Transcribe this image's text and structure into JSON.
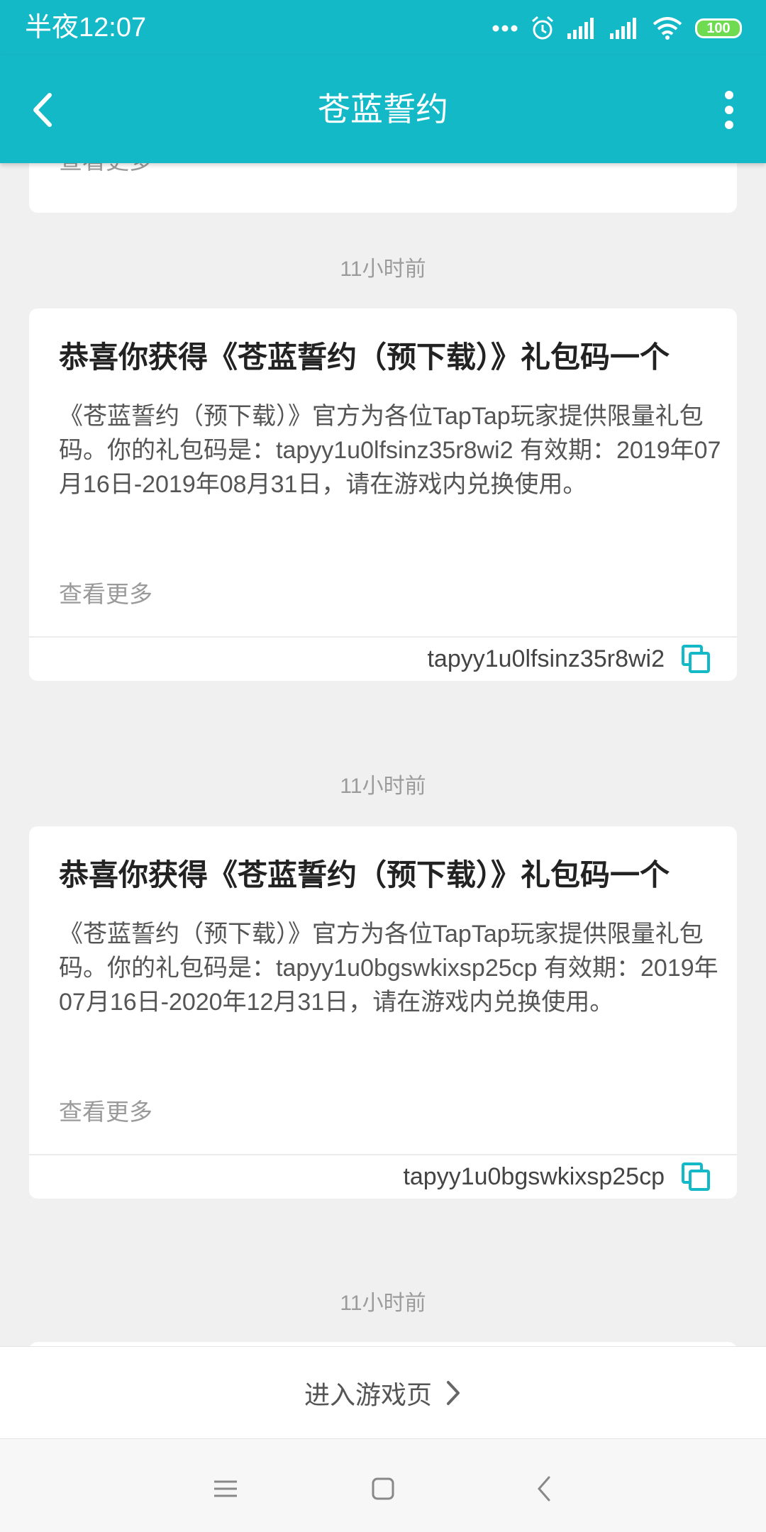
{
  "status_bar": {
    "time": "半夜12:07",
    "battery": "100"
  },
  "app_bar": {
    "title": "苍蓝誓约"
  },
  "feed": {
    "partial_see_more": "查看更多",
    "items": [
      {
        "timestamp": "11小时前",
        "title": "恭喜你获得《苍蓝誓约（预下载）》礼包码一个",
        "body": "《苍蓝誓约（预下载）》官方为各位TapTap玩家提供限量礼包码。你的礼包码是：tapyy1u0lfsinz35r8wi2 有效期：2019年07月16日-2019年08月31日，请在游戏内兑换使用。",
        "see_more": "查看更多",
        "code": "tapyy1u0lfsinz35r8wi2"
      },
      {
        "timestamp": "11小时前",
        "title": "恭喜你获得《苍蓝誓约（预下载）》礼包码一个",
        "body": "《苍蓝誓约（预下载）》官方为各位TapTap玩家提供限量礼包码。你的礼包码是：tapyy1u0bgswkixsp25cp 有效期：2019年07月16日-2020年12月31日，请在游戏内兑换使用。",
        "see_more": "查看更多",
        "code": "tapyy1u0bgswkixsp25cp"
      },
      {
        "timestamp": "11小时前"
      }
    ]
  },
  "bottom_action": {
    "label": "进入游戏页"
  },
  "colors": {
    "accent": "#14b9c8",
    "battery_fill": "#6fdb50",
    "background": "#f0f0f0"
  }
}
